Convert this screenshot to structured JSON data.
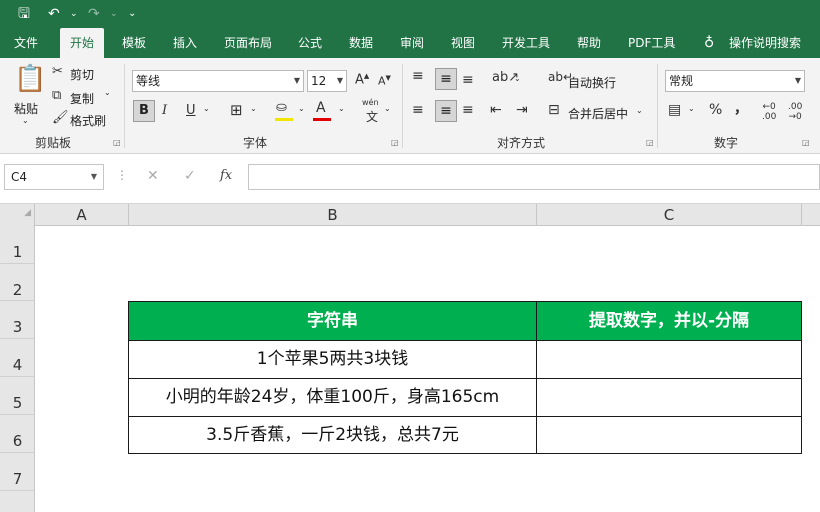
{
  "quick_access": {
    "save_icon": "save-icon",
    "undo_icon": "undo-icon",
    "redo_icon": "redo-icon",
    "customize_icon": "customize-icon"
  },
  "tabs": [
    "文件",
    "开始",
    "模板",
    "插入",
    "页面布局",
    "公式",
    "数据",
    "审阅",
    "视图",
    "开发工具",
    "帮助",
    "PDF工具"
  ],
  "tell_me": "操作说明搜索",
  "clipboard": {
    "paste": "粘贴",
    "cut": "剪切",
    "copy": "复制",
    "format_painter": "格式刷",
    "label": "剪贴板"
  },
  "font": {
    "name": "等线",
    "size": "12",
    "label": "字体",
    "bold": "B",
    "italic": "I",
    "underline": "U",
    "font_color_letter": "A",
    "phonetic": "wén"
  },
  "alignment": {
    "wrap_text": "自动换行",
    "merge_center": "合并后居中",
    "label": "对齐方式"
  },
  "number": {
    "format": "常规",
    "percent": "%",
    "comma": "，",
    "label": "数字"
  },
  "formula_bar": {
    "name_box": "C4",
    "cancel": "✕",
    "enter": "✓",
    "fx": "fx",
    "content": ""
  },
  "columns": [
    "A",
    "B",
    "C"
  ],
  "rows": [
    "1",
    "2",
    "3",
    "4",
    "5",
    "6",
    "7"
  ],
  "table": {
    "headers": [
      "字符串",
      "提取数字，并以-分隔"
    ],
    "rows": [
      [
        "1个苹果5两共3块钱",
        ""
      ],
      [
        "小明的年龄24岁，体重100斤，身高165cm",
        ""
      ],
      [
        "3.5斤香蕉，一斤2块钱，总共7元",
        ""
      ]
    ]
  },
  "colors": {
    "brand": "#217346",
    "header_fill": "#00b050"
  }
}
